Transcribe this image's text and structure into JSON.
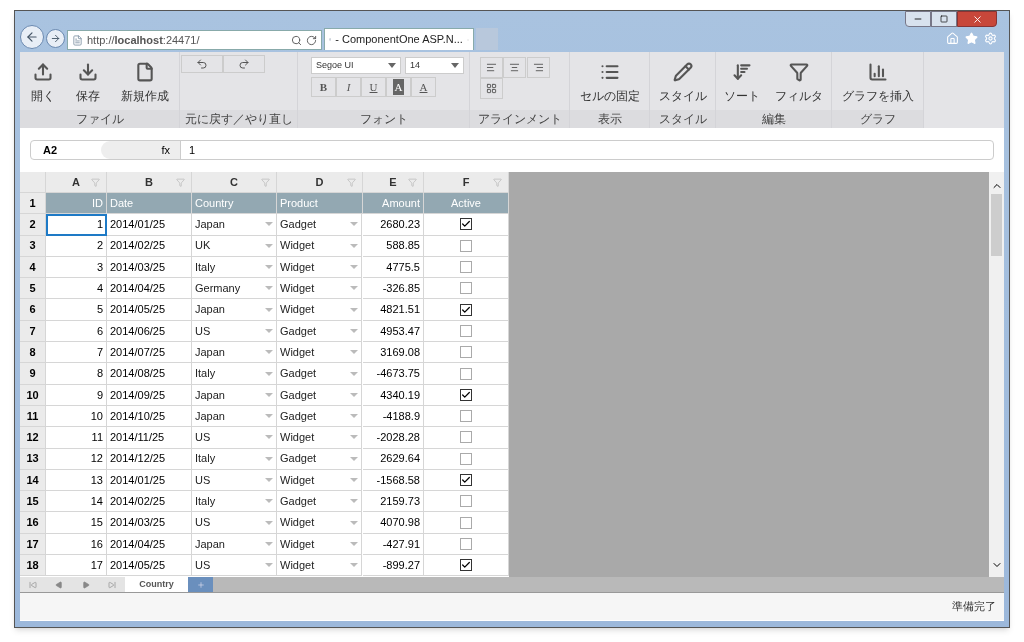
{
  "browser": {
    "address": "http://**localhost**:24471/",
    "tab_title": "- ComponentOne ASP.N..."
  },
  "ribbon": [
    {
      "kind": "buttons",
      "label": "ファイル",
      "buttons": [
        {
          "label": "開く"
        },
        {
          "label": "保存"
        },
        {
          "label": "新規作成"
        }
      ]
    },
    {
      "kind": "history",
      "label": "元に戻す／やり直し"
    },
    {
      "kind": "font",
      "label": "フォント",
      "font_name": "Segoe UI",
      "font_size": "14",
      "styles": [
        "B",
        "I",
        "U",
        "A",
        "A"
      ]
    },
    {
      "kind": "align",
      "label": "アラインメント"
    },
    {
      "kind": "buttons",
      "label": "表示",
      "buttons": [
        {
          "label": "セルの固定"
        }
      ]
    },
    {
      "kind": "buttons",
      "label": "スタイル",
      "buttons": [
        {
          "label": "スタイル"
        }
      ]
    },
    {
      "kind": "buttons",
      "label": "編集",
      "buttons": [
        {
          "label": "ソート"
        },
        {
          "label": "フィルタ"
        }
      ]
    },
    {
      "kind": "buttons",
      "label": "グラフ",
      "buttons": [
        {
          "label": "グラフを挿入"
        }
      ]
    }
  ],
  "formula": {
    "cell": "A2",
    "fx": "fx",
    "value": "1"
  },
  "columns": [
    "A",
    "B",
    "C",
    "D",
    "E",
    "F"
  ],
  "header_row": {
    "number": "1",
    "cells": [
      "ID",
      "Date",
      "Country",
      "Product",
      "Amount",
      "Active"
    ]
  },
  "rows": [
    {
      "number": "2",
      "id": "1",
      "date": "2014/01/25",
      "country": "Japan",
      "product": "Gadget",
      "amount": "2680.23",
      "active": true,
      "selected": true
    },
    {
      "number": "3",
      "id": "2",
      "date": "2014/02/25",
      "country": "UK",
      "product": "Widget",
      "amount": "588.85",
      "active": false,
      "selected": false
    },
    {
      "number": "4",
      "id": "3",
      "date": "2014/03/25",
      "country": "Italy",
      "product": "Widget",
      "amount": "4775.5",
      "active": false,
      "selected": false
    },
    {
      "number": "5",
      "id": "4",
      "date": "2014/04/25",
      "country": "Germany",
      "product": "Widget",
      "amount": "-326.85",
      "active": false,
      "selected": false
    },
    {
      "number": "6",
      "id": "5",
      "date": "2014/05/25",
      "country": "Japan",
      "product": "Widget",
      "amount": "4821.51",
      "active": true,
      "selected": false
    },
    {
      "number": "7",
      "id": "6",
      "date": "2014/06/25",
      "country": "US",
      "product": "Gadget",
      "amount": "4953.47",
      "active": false,
      "selected": false
    },
    {
      "number": "8",
      "id": "7",
      "date": "2014/07/25",
      "country": "Japan",
      "product": "Widget",
      "amount": "3169.08",
      "active": false,
      "selected": false
    },
    {
      "number": "9",
      "id": "8",
      "date": "2014/08/25",
      "country": "Italy",
      "product": "Gadget",
      "amount": "-4673.75",
      "active": false,
      "selected": false
    },
    {
      "number": "10",
      "id": "9",
      "date": "2014/09/25",
      "country": "Japan",
      "product": "Gadget",
      "amount": "4340.19",
      "active": true,
      "selected": false
    },
    {
      "number": "11",
      "id": "10",
      "date": "2014/10/25",
      "country": "Japan",
      "product": "Gadget",
      "amount": "-4188.9",
      "active": false,
      "selected": false
    },
    {
      "number": "12",
      "id": "11",
      "date": "2014/11/25",
      "country": "US",
      "product": "Widget",
      "amount": "-2028.28",
      "active": false,
      "selected": false
    },
    {
      "number": "13",
      "id": "12",
      "date": "2014/12/25",
      "country": "Italy",
      "product": "Gadget",
      "amount": "2629.64",
      "active": false,
      "selected": false
    },
    {
      "number": "14",
      "id": "13",
      "date": "2014/01/25",
      "country": "US",
      "product": "Widget",
      "amount": "-1568.58",
      "active": true,
      "selected": false
    },
    {
      "number": "15",
      "id": "14",
      "date": "2014/02/25",
      "country": "Italy",
      "product": "Gadget",
      "amount": "2159.73",
      "active": false,
      "selected": false
    },
    {
      "number": "16",
      "id": "15",
      "date": "2014/03/25",
      "country": "US",
      "product": "Widget",
      "amount": "4070.98",
      "active": false,
      "selected": false
    },
    {
      "number": "17",
      "id": "16",
      "date": "2014/04/25",
      "country": "Japan",
      "product": "Widget",
      "amount": "-427.91",
      "active": false,
      "selected": false
    },
    {
      "number": "18",
      "id": "17",
      "date": "2014/05/25",
      "country": "US",
      "product": "Widget",
      "amount": "-899.27",
      "active": true,
      "selected": false
    }
  ],
  "sheets": [
    {
      "label": "Country",
      "selected": true
    }
  ],
  "status": "準備完了"
}
